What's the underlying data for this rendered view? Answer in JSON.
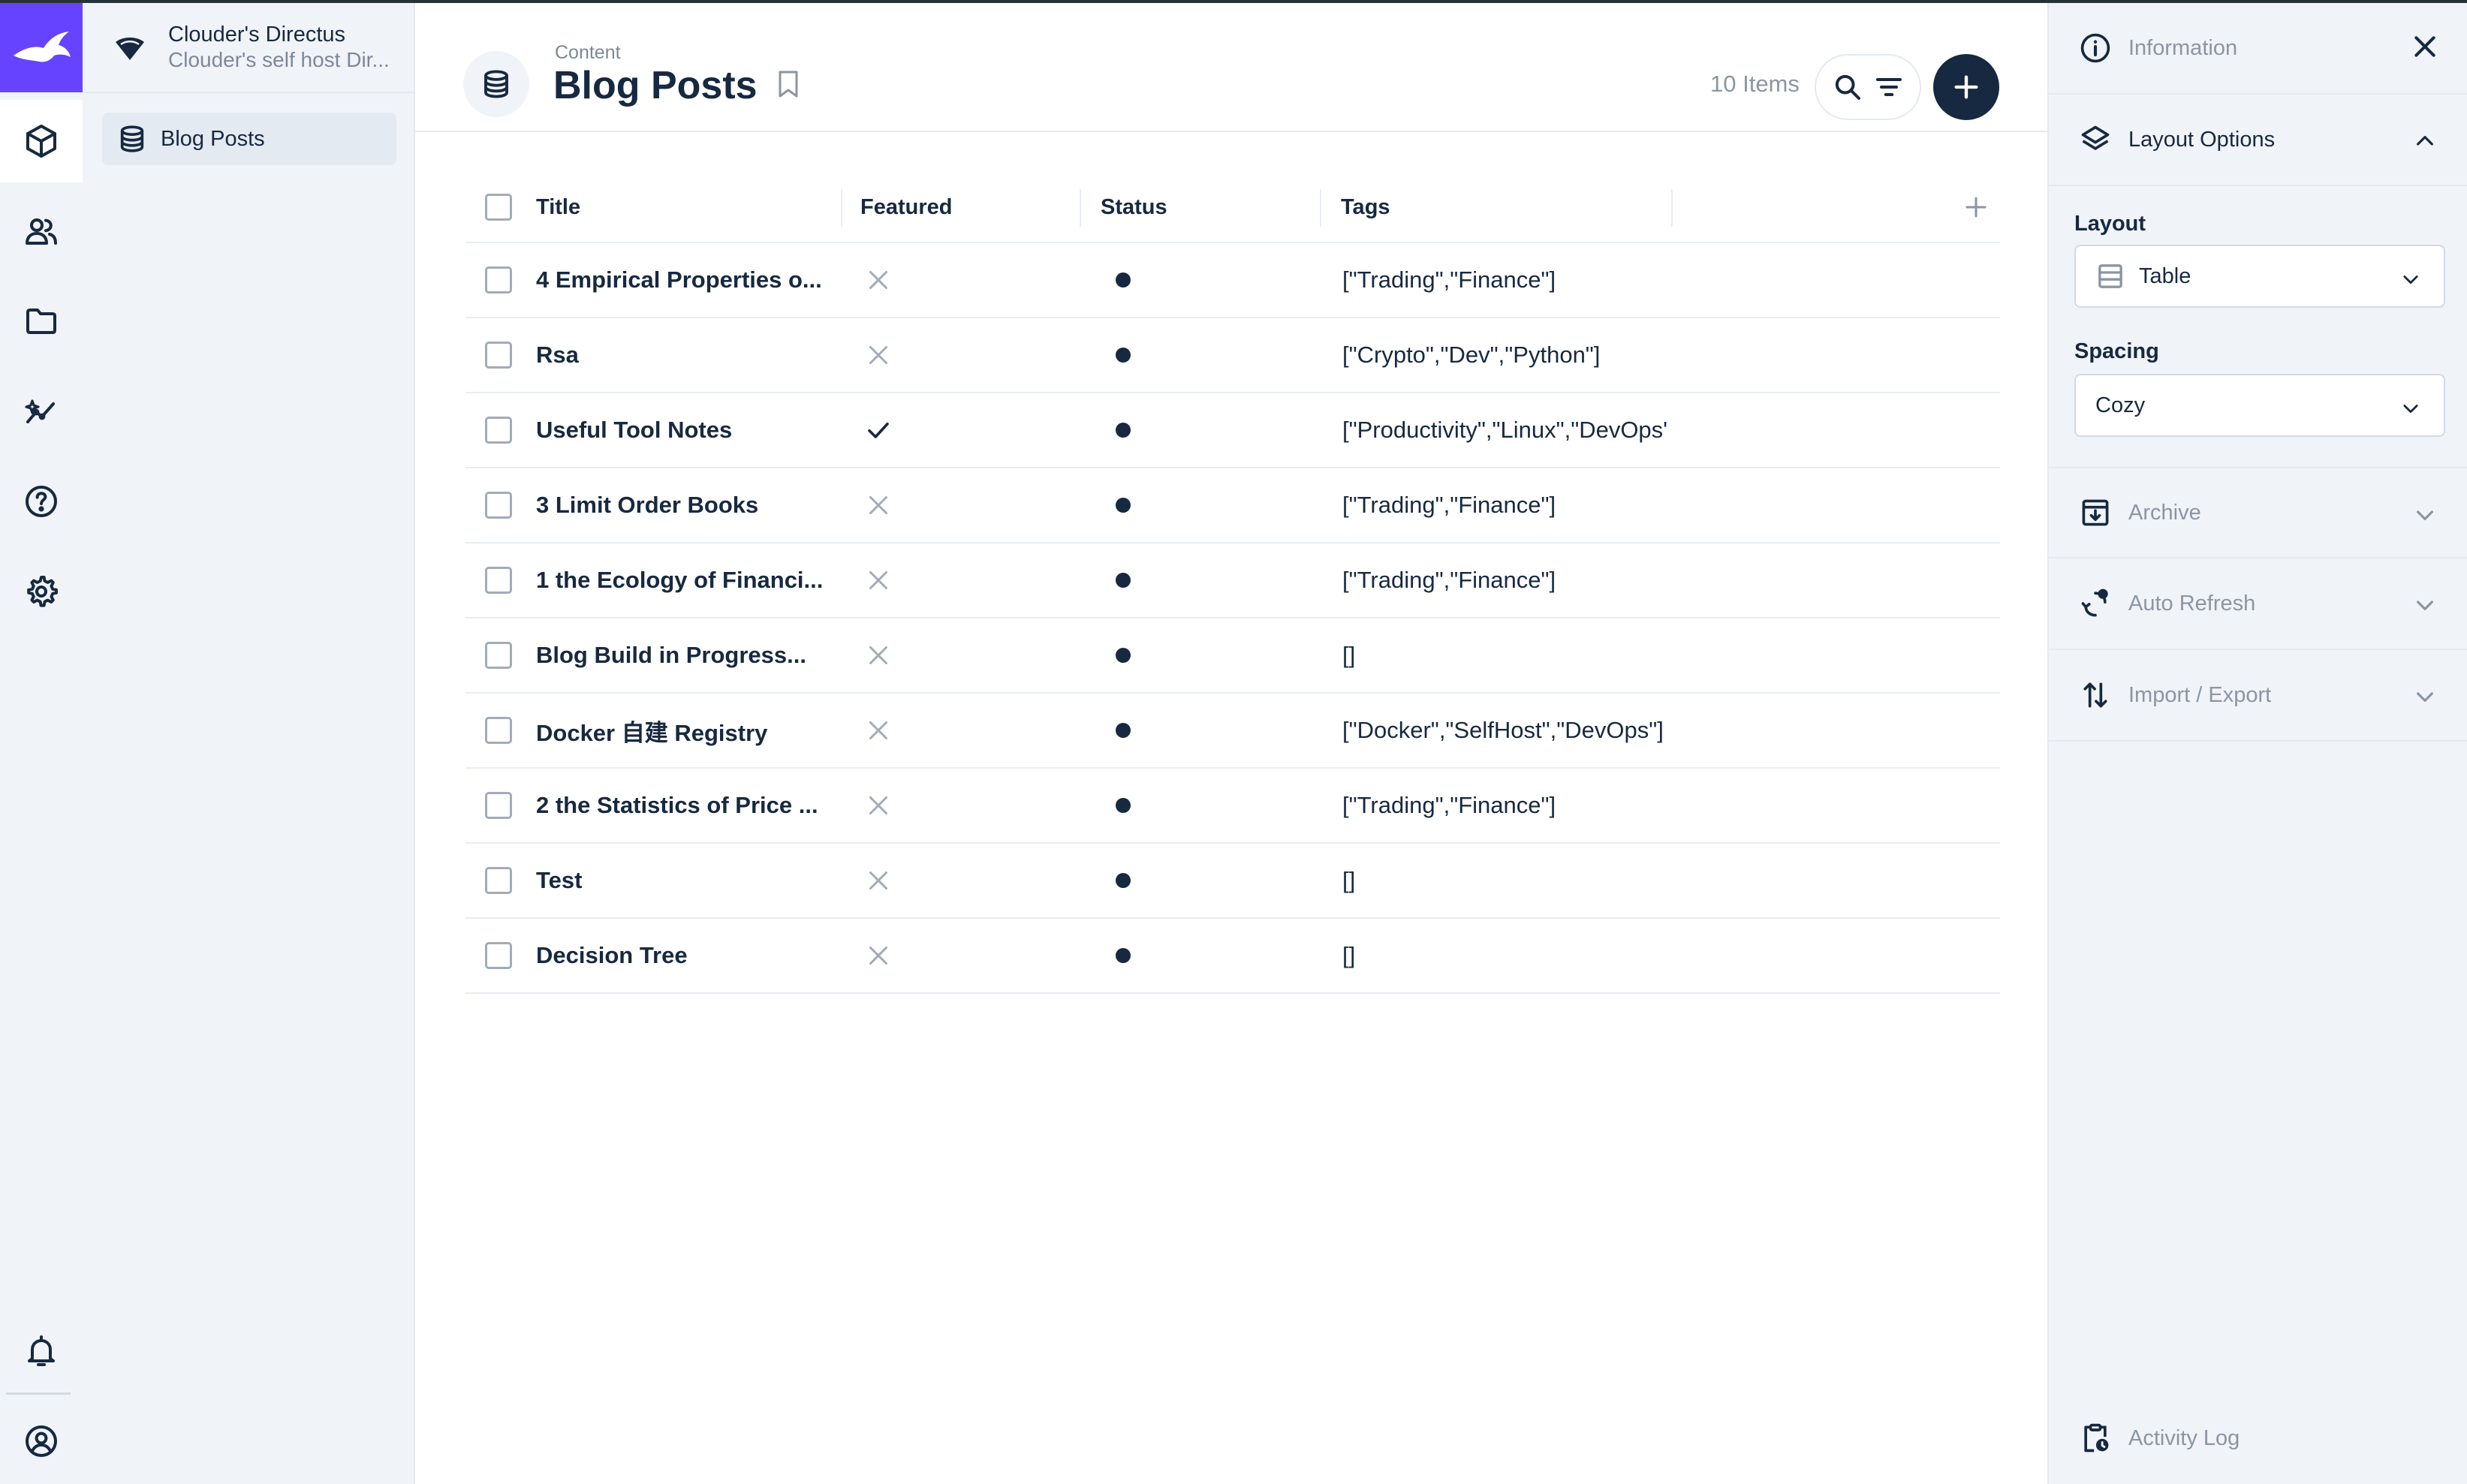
{
  "project": {
    "name": "Clouder's Directus",
    "description": "Clouder's self host Dir..."
  },
  "nav": {
    "items": [
      {
        "label": "Blog Posts",
        "icon": "database-icon"
      }
    ]
  },
  "modules": [
    "content-icon",
    "users-icon",
    "files-icon",
    "insights-icon",
    "help-icon",
    "settings-icon",
    "notifications-icon",
    "user-profile-icon"
  ],
  "header": {
    "breadcrumb": "Content",
    "title": "Blog Posts",
    "item_count": "10 Items"
  },
  "table": {
    "columns": [
      "Title",
      "Featured",
      "Status",
      "Tags"
    ],
    "rows": [
      {
        "title": "4 Empirical Properties o...",
        "featured": false,
        "status": "dot",
        "tags": "[\"Trading\",\"Finance\"]"
      },
      {
        "title": "Rsa",
        "featured": false,
        "status": "dot",
        "tags": "[\"Crypto\",\"Dev\",\"Python\"]"
      },
      {
        "title": "Useful Tool Notes",
        "featured": true,
        "status": "dot",
        "tags": "[\"Productivity\",\"Linux\",\"DevOps'"
      },
      {
        "title": "3 Limit Order Books",
        "featured": false,
        "status": "dot",
        "tags": "[\"Trading\",\"Finance\"]"
      },
      {
        "title": "1 the Ecology of Financi...",
        "featured": false,
        "status": "dot",
        "tags": "[\"Trading\",\"Finance\"]"
      },
      {
        "title": "Blog Build in Progress...",
        "featured": false,
        "status": "dot",
        "tags": "[]"
      },
      {
        "title": "Docker 自建 Registry",
        "featured": false,
        "status": "dot",
        "tags": "[\"Docker\",\"SelfHost\",\"DevOps\"]"
      },
      {
        "title": "2 the Statistics of Price ...",
        "featured": false,
        "status": "dot",
        "tags": "[\"Trading\",\"Finance\"]"
      },
      {
        "title": "Test",
        "featured": false,
        "status": "dot",
        "tags": "[]"
      },
      {
        "title": "Decision Tree",
        "featured": false,
        "status": "dot",
        "tags": "[]"
      }
    ]
  },
  "sidebar": {
    "information": "Information",
    "layout_options": "Layout Options",
    "layout_label": "Layout",
    "layout_value": "Table",
    "spacing_label": "Spacing",
    "spacing_value": "Cozy",
    "archive": "Archive",
    "auto_refresh": "Auto Refresh",
    "import_export": "Import / Export",
    "activity_log": "Activity Log"
  },
  "colors": {
    "brand": "#6644ff",
    "dark": "#172940",
    "muted": "#8b95a3",
    "background": "#f0f4f9"
  }
}
